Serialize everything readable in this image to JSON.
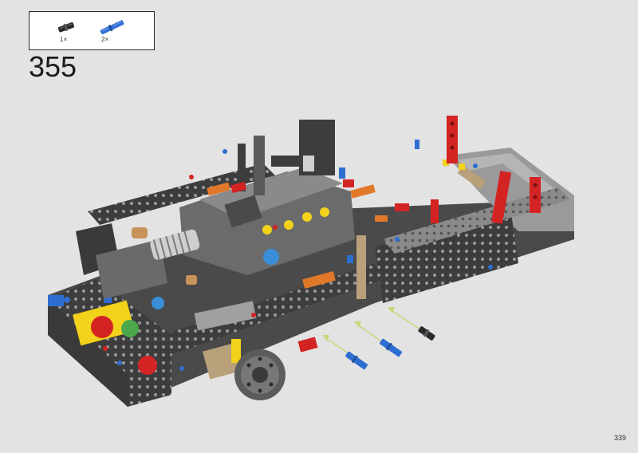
{
  "parts_callout": {
    "items": [
      {
        "icon": "black-friction-pin-icon",
        "quantity": "1×",
        "color": "#2b2b2b"
      },
      {
        "icon": "blue-axle-pin-icon",
        "quantity": "2×",
        "color": "#2f6ed1"
      }
    ]
  },
  "step": {
    "number": "355"
  },
  "page": {
    "number": "339"
  },
  "colors": {
    "background": "#e3e3e3",
    "frame_dark": "#3a3a3a",
    "frame_light": "#8c8c8c",
    "accent_red": "#d42323",
    "accent_orange": "#e0782a",
    "accent_blue": "#2f6ed1",
    "accent_yellow": "#f2d21a",
    "accent_tan": "#b8a07a",
    "assembly_arrow": "#c9d67a"
  }
}
